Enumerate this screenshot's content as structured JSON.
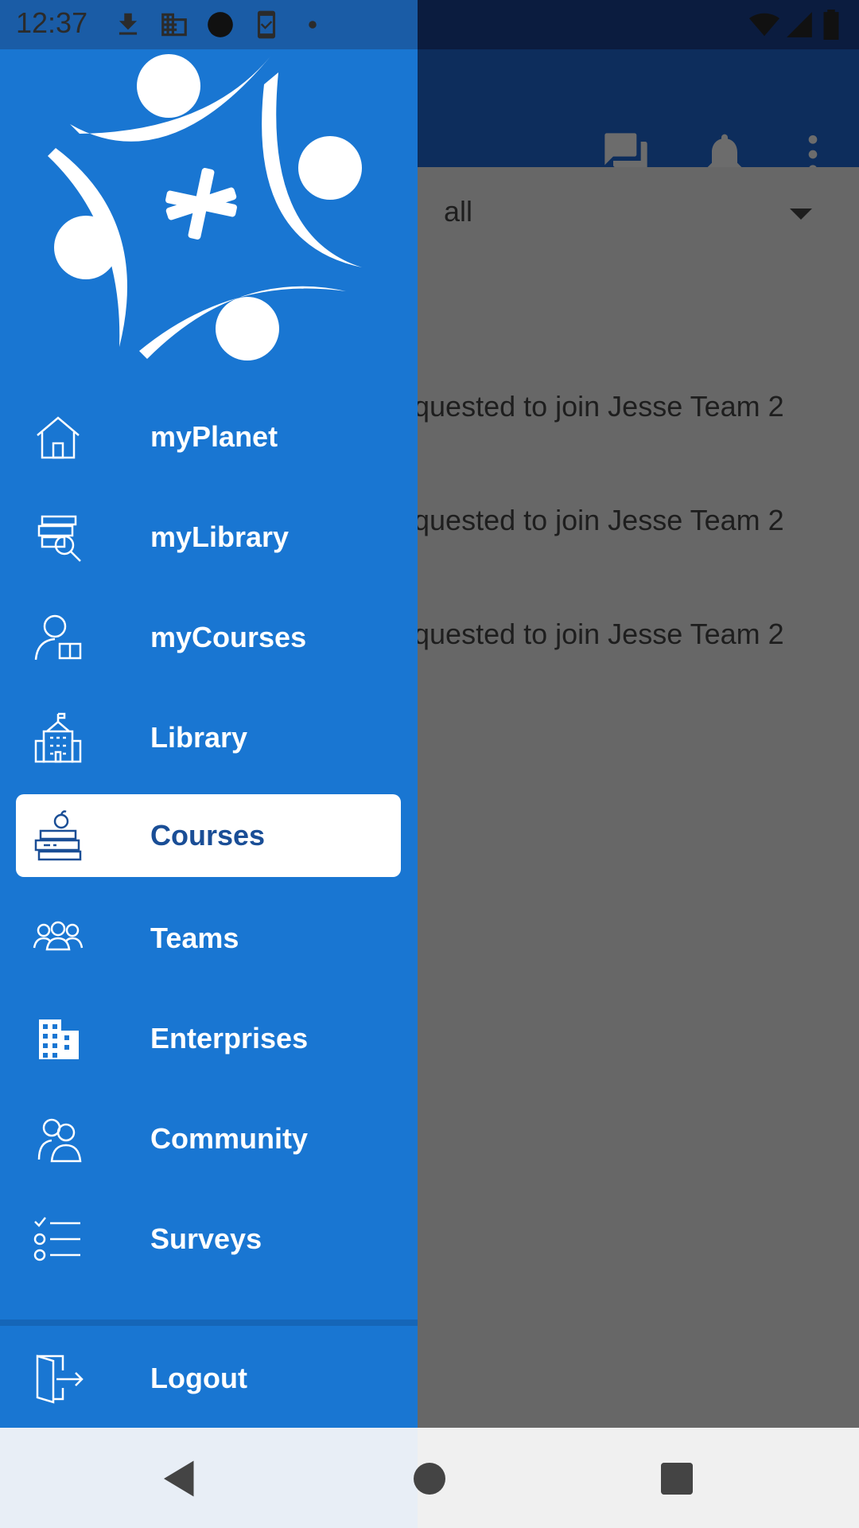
{
  "status_bar": {
    "time": "12:37"
  },
  "background": {
    "filter_value": "all",
    "notifications": [
      "quested to join Jesse Team 2",
      "quested to join Jesse Team 2",
      "quested to join Jesse Team 2"
    ]
  },
  "drawer": {
    "items": [
      {
        "label": "myPlanet",
        "icon": "home-icon"
      },
      {
        "label": "myLibrary",
        "icon": "book-search-icon"
      },
      {
        "label": "myCourses",
        "icon": "user-book-icon"
      },
      {
        "label": "Library",
        "icon": "building-icon"
      },
      {
        "label": "Courses",
        "icon": "books-apple-icon",
        "active": true
      },
      {
        "label": "Teams",
        "icon": "team-icon"
      },
      {
        "label": "Enterprises",
        "icon": "enterprise-icon"
      },
      {
        "label": "Community",
        "icon": "community-icon"
      },
      {
        "label": "Surveys",
        "icon": "checklist-icon"
      }
    ],
    "logout_label": "Logout"
  },
  "colors": {
    "drawer": "#1976d2",
    "active_text": "#1a4e96",
    "scrim": "#676767"
  }
}
